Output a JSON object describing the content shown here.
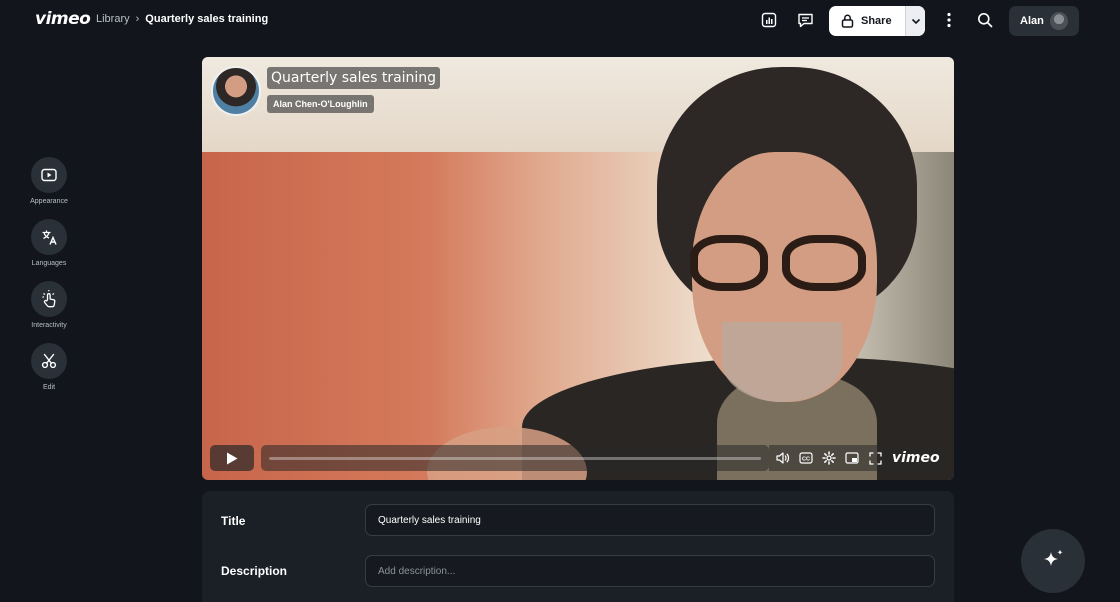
{
  "app": {
    "logo": "vimeo"
  },
  "breadcrumb": {
    "library": "Library",
    "separator": "›",
    "current": "Quarterly sales training"
  },
  "toolbar": {
    "analytics_icon": "bar-chart-icon",
    "comments_icon": "comment-icon",
    "share_label": "Share",
    "more_icon": "more-vertical-icon",
    "search_icon": "search-icon",
    "user_name": "Alan"
  },
  "sidebar": {
    "items": [
      {
        "label": "Appearance",
        "icon": "play-box-icon"
      },
      {
        "label": "Languages",
        "icon": "translate-icon"
      },
      {
        "label": "Interactivity",
        "icon": "tap-hand-icon"
      },
      {
        "label": "Edit",
        "icon": "scissors-icon"
      }
    ]
  },
  "video": {
    "title": "Quarterly sales training",
    "author": "Alan Chen-O'Loughlin",
    "brand": "vimeo",
    "progress": 0
  },
  "form": {
    "title_label": "Title",
    "title_value": "Quarterly sales training",
    "description_label": "Description",
    "description_placeholder": "Add description..."
  },
  "colors": {
    "background": "#12161c",
    "surface": "#2a3038",
    "panel": "#1b2027",
    "accent": "#ffffff"
  }
}
